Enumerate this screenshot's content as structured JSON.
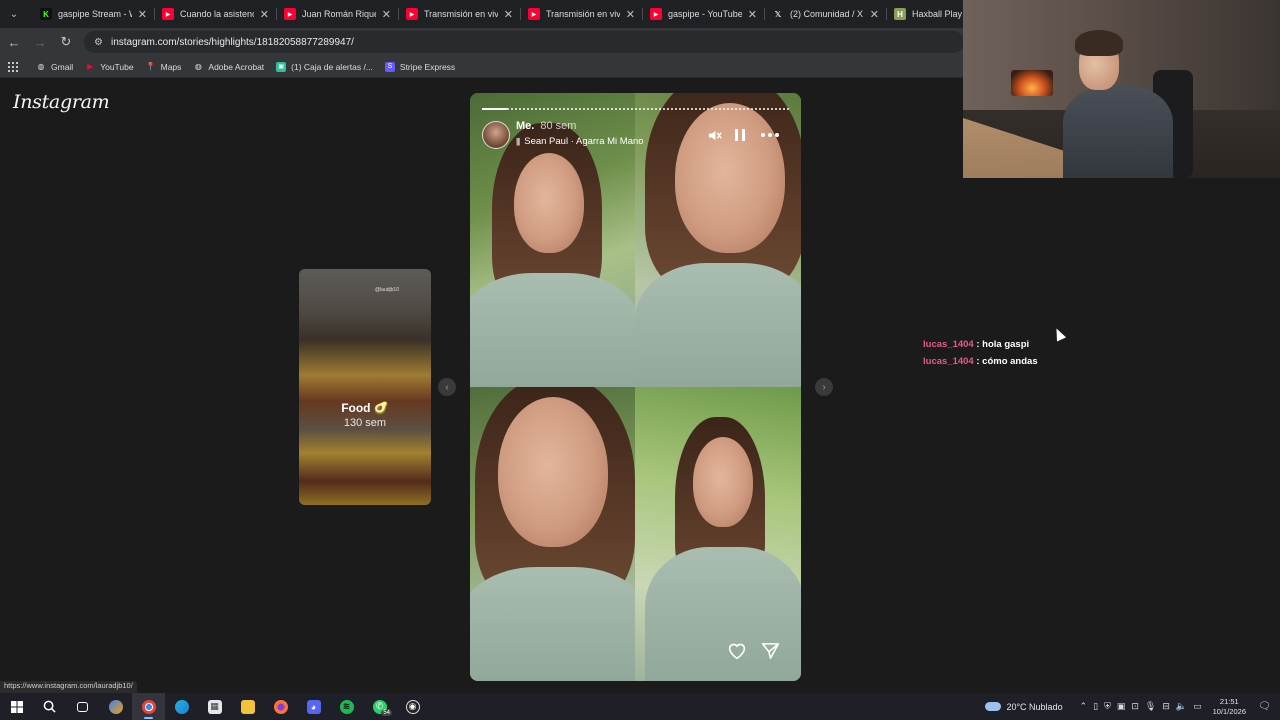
{
  "tabs": [
    {
      "title": "gaspipe Stream - Wa",
      "favicon": "kick-icon",
      "color": "#53fc18"
    },
    {
      "title": "Cuando la asistencia",
      "favicon": "youtube-icon",
      "color": "#ff0033"
    },
    {
      "title": "Juan Román Riquelme",
      "favicon": "youtube-icon",
      "color": "#ff0033"
    },
    {
      "title": "Transmisión en vivo d",
      "favicon": "youtube-icon",
      "color": "#ff0033"
    },
    {
      "title": "Transmisión en vivo d",
      "favicon": "youtube-icon",
      "color": "#ff0033"
    },
    {
      "title": "gaspipe - YouTube",
      "favicon": "youtube-icon",
      "color": "#ff0033"
    },
    {
      "title": "(2) Comunidad / X",
      "favicon": "x-icon",
      "color": "#ffffff"
    },
    {
      "title": "Haxball Play",
      "favicon": "haxball-icon",
      "color": "#8aa05a"
    }
  ],
  "url": "instagram.com/stories/highlights/18182058877289947/",
  "bookmarks": [
    {
      "label": "Gmail",
      "icon": "globe-icon"
    },
    {
      "label": "YouTube",
      "icon": "youtube-icon"
    },
    {
      "label": "Maps",
      "icon": "maps-icon"
    },
    {
      "label": "Adobe Acrobat",
      "icon": "globe-icon"
    },
    {
      "label": "(1) Caja de alertas /...",
      "icon": "alerts-icon"
    },
    {
      "label": "Stripe Express",
      "icon": "stripe-icon"
    }
  ],
  "instagram": {
    "logo": "Instagram",
    "preview": {
      "title": "Food 🥑",
      "time": "130 sem",
      "tag": "@laudjb10"
    },
    "story": {
      "username": "Me.",
      "time": "80 sem",
      "music": "Sean Paul · Agarra Mi Mano",
      "progress": 0.08
    }
  },
  "chat": [
    {
      "user": "lucas_1404",
      "message": "hola gaspi"
    },
    {
      "user": "lucas_1404",
      "message": "cómo andas"
    }
  ],
  "status_url": "https://www.instagram.com/lauradjb10/",
  "taskbar": {
    "weather": "20°C  Nublado",
    "time": "21:51",
    "date": "10/1/2026",
    "whatsapp_badge": "54"
  }
}
